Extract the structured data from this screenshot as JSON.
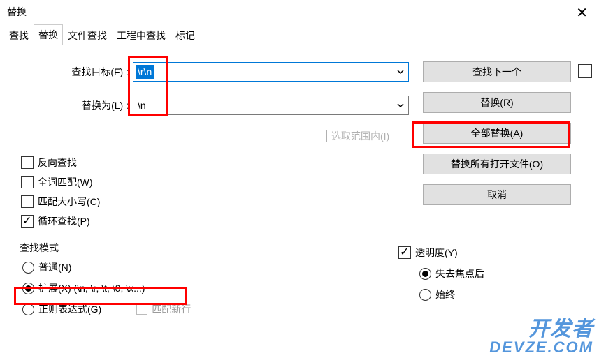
{
  "window": {
    "title": "替换"
  },
  "tabs": {
    "find": "查找",
    "replace": "替换",
    "findInFiles": "文件查找",
    "findInProj": "工程中查找",
    "mark": "标记"
  },
  "labels": {
    "findTarget": "查找目标(F) :",
    "replaceWith": "替换为(L) :",
    "inSelection": "选取范围内(I)"
  },
  "fields": {
    "find": "\\r\\n",
    "replace": "\\n"
  },
  "buttons": {
    "findNext": "查找下一个",
    "replace": "替换(R)",
    "replaceAll": "全部替换(A)",
    "replaceAllOpen": "替换所有打开文件(O)",
    "cancel": "取消"
  },
  "options": {
    "backward": "反向查找",
    "wholeWord": "全词匹配(W)",
    "matchCase": "匹配大小写(C)",
    "wrap": "循环查找(P)"
  },
  "mode": {
    "groupLabel": "查找模式",
    "normal": "普通(N)",
    "extended": "扩展(X) (\\n, \\r, \\t, \\0, \\x...)",
    "regex": "正则表达式(G)",
    "matchNewline": "匹配新行"
  },
  "transparency": {
    "label": "透明度(Y)",
    "onLoseFocus": "失去焦点后",
    "always": "始终"
  },
  "watermark": {
    "line1": "开发者",
    "line2": "DEVZE.COM"
  }
}
